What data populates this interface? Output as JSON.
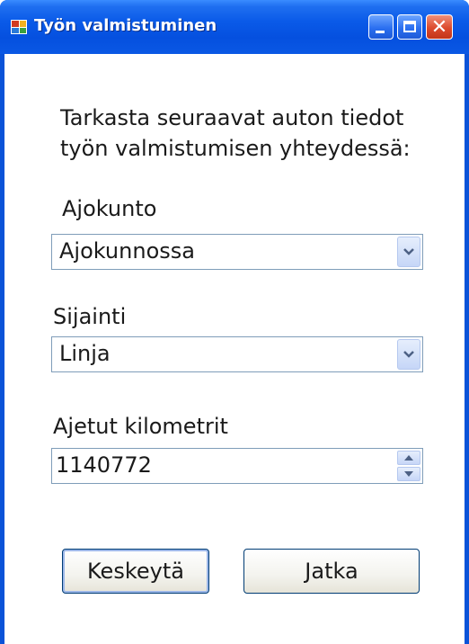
{
  "window": {
    "title": "Työn valmistuminen"
  },
  "form": {
    "instructions_line1": "Tarkasta seuraavat auton tiedot",
    "instructions_line2": "työn valmistumisen yhteydessä:",
    "ajokunto": {
      "label": "Ajokunto",
      "value": "Ajokunnossa"
    },
    "sijainti": {
      "label": "Sijainti",
      "value": "Linja"
    },
    "kilometrit": {
      "label": "Ajetut kilometrit",
      "value": "1140772"
    }
  },
  "buttons": {
    "cancel": "Keskeytä",
    "continue": "Jatka"
  },
  "icons": {
    "app": "app-window-icon",
    "minimize": "minimize-icon",
    "maximize": "maximize-icon",
    "close": "close-icon",
    "dropdown": "chevron-down-icon",
    "spin_up": "spin-up-icon",
    "spin_down": "spin-down-icon"
  },
  "colors": {
    "titlebar": "#0a5ae8",
    "close_button": "#dc4a2c",
    "field_border": "#7f9db9"
  }
}
